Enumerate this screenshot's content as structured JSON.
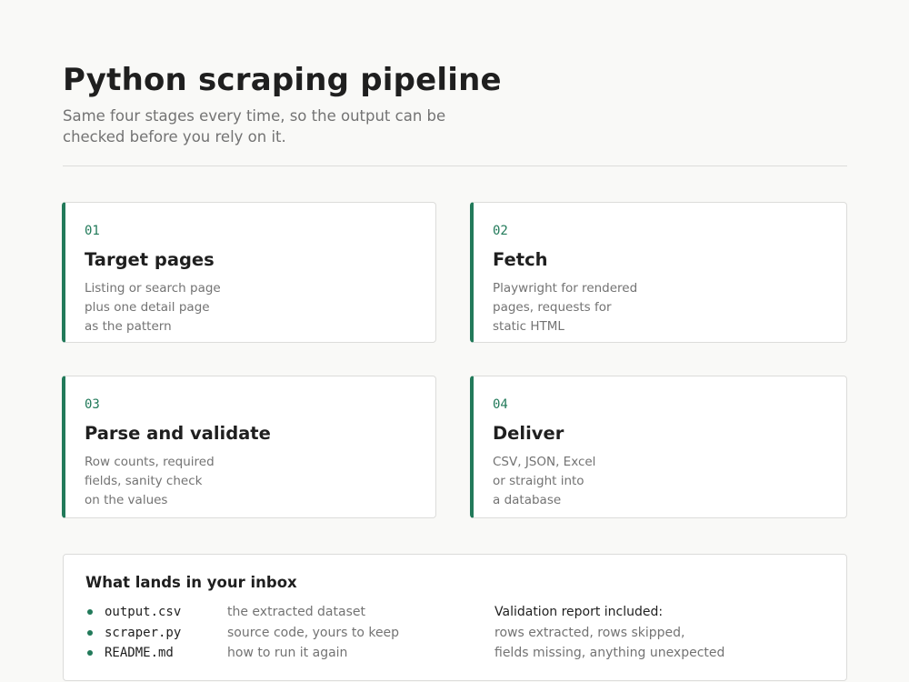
{
  "header": {
    "title": "Python scraping pipeline",
    "subtitle": "Same four stages every time, so the output can be checked before you rely on it."
  },
  "colors": {
    "accent": "#227a5a",
    "background": "#f9f9f7",
    "muted_text": "#737373"
  },
  "stages": [
    {
      "number": "01",
      "title": "Target pages",
      "description": [
        "Listing or search page",
        "plus one detail page",
        "as the pattern"
      ]
    },
    {
      "number": "02",
      "title": "Fetch",
      "description": [
        "Playwright for rendered",
        "pages, requests for",
        "static HTML"
      ]
    },
    {
      "number": "03",
      "title": "Parse and validate",
      "description": [
        "Row counts, required",
        "fields, sanity check",
        "on the values"
      ]
    },
    {
      "number": "04",
      "title": "Deliver",
      "description": [
        "CSV, JSON, Excel",
        "or straight into",
        "a database"
      ]
    }
  ],
  "inbox": {
    "title": "What lands in your inbox",
    "files": [
      {
        "name": "output.csv",
        "description": "the extracted dataset"
      },
      {
        "name": "scraper.py",
        "description": "source code, yours to keep"
      },
      {
        "name": "README.md",
        "description": "how to run it again"
      }
    ],
    "report": {
      "heading": "Validation report included:",
      "lines": [
        "rows extracted, rows skipped,",
        "fields missing, anything unexpected"
      ]
    }
  }
}
